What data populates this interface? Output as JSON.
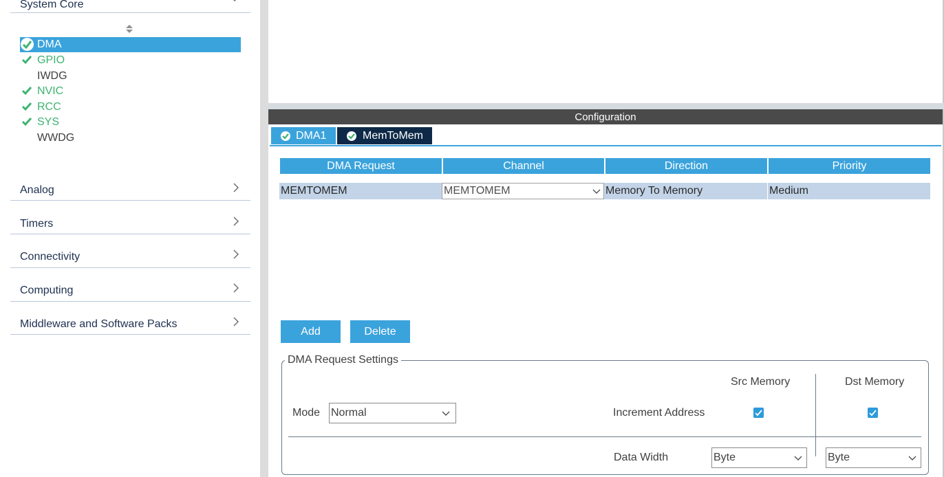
{
  "sidebar": {
    "categories": [
      {
        "label": "System Core"
      },
      {
        "label": "Analog"
      },
      {
        "label": "Timers"
      },
      {
        "label": "Connectivity"
      },
      {
        "label": "Computing"
      },
      {
        "label": "Middleware and Software Packs"
      }
    ],
    "peripherals": [
      {
        "label": "DMA",
        "status": "selected"
      },
      {
        "label": "GPIO",
        "status": "ok"
      },
      {
        "label": "IWDG",
        "status": "none"
      },
      {
        "label": "NVIC",
        "status": "ok"
      },
      {
        "label": "RCC",
        "status": "ok"
      },
      {
        "label": "SYS",
        "status": "ok"
      },
      {
        "label": "WWDG",
        "status": "none"
      }
    ]
  },
  "config": {
    "header": "Configuration",
    "tabs": [
      {
        "label": "DMA1",
        "active": false
      },
      {
        "label": "MemToMem",
        "active": true
      }
    ],
    "table": {
      "columns": [
        "DMA Request",
        "Channel",
        "Direction",
        "Priority"
      ],
      "rows": [
        {
          "request": "MEMTOMEM",
          "channel": "MEMTOMEM",
          "direction": "Memory To Memory",
          "priority": "Medium"
        }
      ]
    },
    "buttons": {
      "add": "Add",
      "delete": "Delete"
    },
    "settings": {
      "title": "DMA Request Settings",
      "src_header": "Src Memory",
      "dst_header": "Dst Memory",
      "mode_label": "Mode",
      "mode_value": "Normal",
      "increment_label": "Increment Address",
      "src_increment": true,
      "dst_increment": true,
      "width_label": "Data Width",
      "src_width": "Byte",
      "dst_width": "Byte"
    }
  },
  "colors": {
    "accent": "#3ba3dc",
    "active_tab": "#0e2947",
    "ok_green": "#3cb371",
    "row_bg": "#c3d4e8",
    "config_bar": "#4a4a4a"
  }
}
